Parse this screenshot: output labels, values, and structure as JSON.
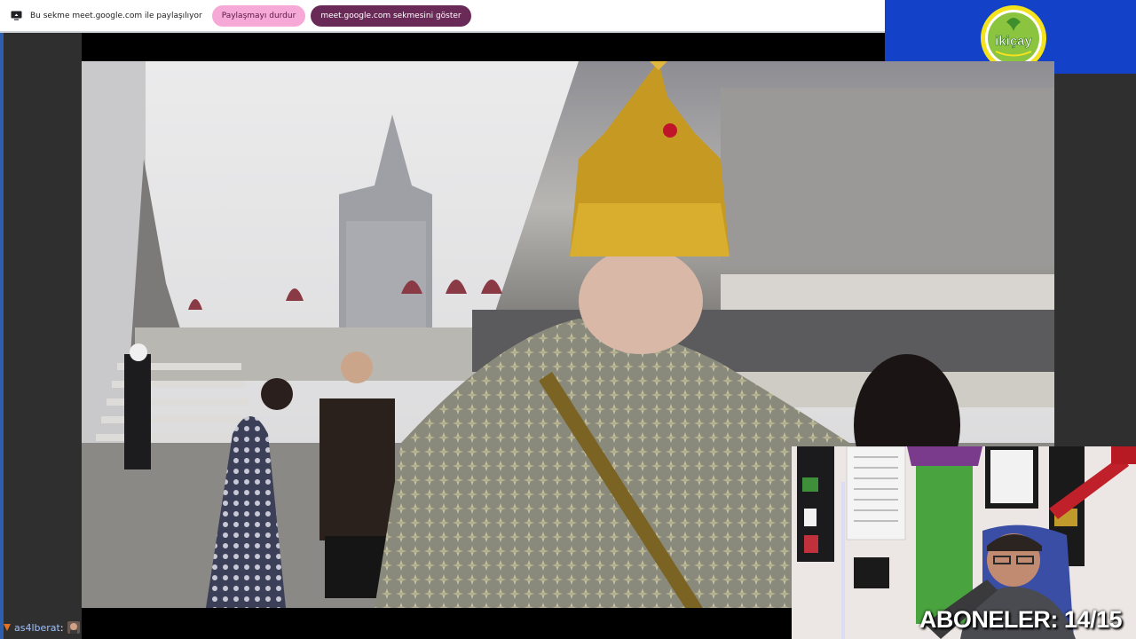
{
  "share_bar": {
    "message": "Bu sekme meet.google.com ile paylaşılıyor",
    "stop_button": "Paylaşmayı durdur",
    "show_tab_button": "meet.google.com sekmesini göster"
  },
  "logo": {
    "brand": "ikiçay",
    "bg_color": "#1342c8"
  },
  "webcam": {
    "subscribers_label": "ABONELER: 14/15"
  },
  "chat": {
    "username": "as4lberat",
    "suffix": ":"
  },
  "colors": {
    "stop_button_bg": "#f6a8d6",
    "show_button_bg": "#6a2a58"
  }
}
